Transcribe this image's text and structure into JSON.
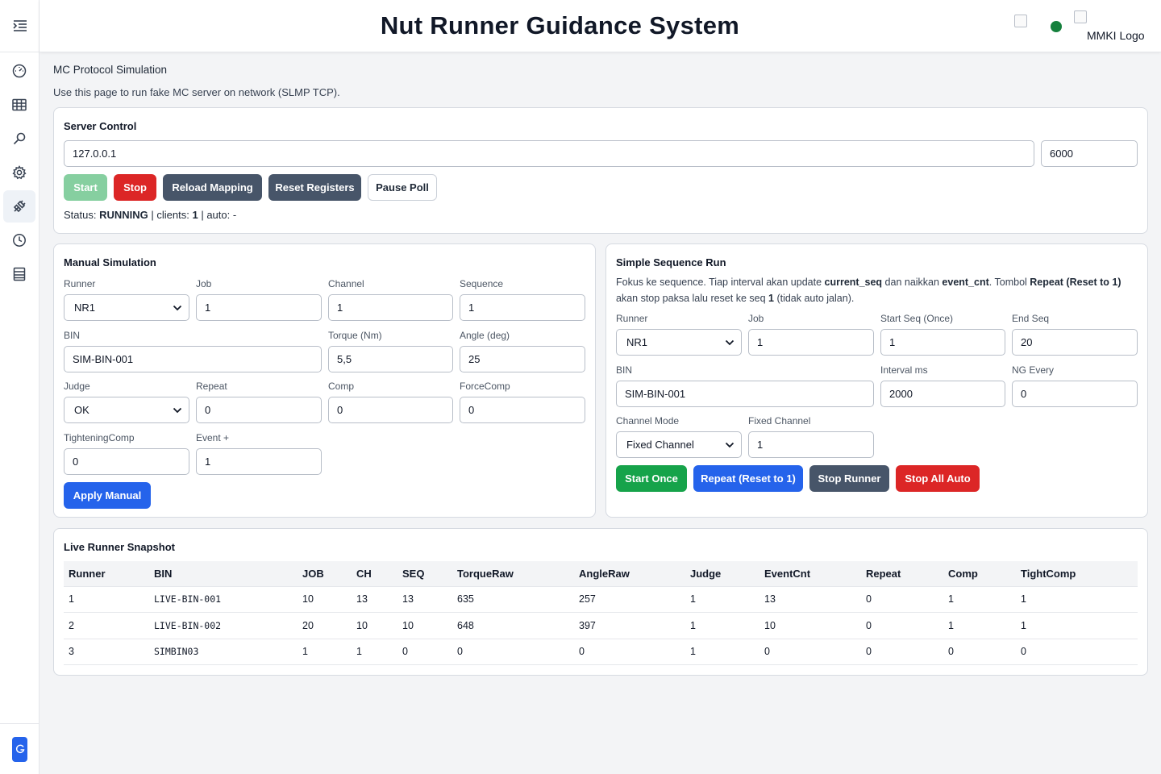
{
  "header": {
    "title": "Nut Runner Guidance System",
    "logo_alt": "MMKI Logo",
    "status_color": "#15803d"
  },
  "sidebar": {
    "items": [
      {
        "icon": "hamburger-menu-icon"
      },
      {
        "icon": "dashboard-gauge-icon"
      },
      {
        "icon": "table-grid-icon"
      },
      {
        "icon": "search-icon"
      },
      {
        "icon": "gear-icon"
      },
      {
        "icon": "plug-link-icon",
        "active": true
      },
      {
        "icon": "clock-history-icon"
      },
      {
        "icon": "list-icon"
      }
    ],
    "avatar_letter": "G"
  },
  "page": {
    "title": "MC Protocol Simulation",
    "description": "Use this page to run fake MC server on network (SLMP TCP)."
  },
  "server_control": {
    "title": "Server Control",
    "host": "127.0.0.1",
    "port": "6000",
    "buttons": {
      "start": "Start",
      "stop": "Stop",
      "reload": "Reload Mapping",
      "reset": "Reset Registers",
      "pause": "Pause Poll"
    },
    "status_label": "Status:",
    "status_value": "RUNNING",
    "clients_label": "| clients:",
    "clients_value": "1",
    "auto_label": "| auto: -"
  },
  "manual": {
    "title": "Manual Simulation",
    "labels": {
      "runner": "Runner",
      "job": "Job",
      "channel": "Channel",
      "sequence": "Sequence",
      "bin": "BIN",
      "torque": "Torque (Nm)",
      "angle": "Angle (deg)",
      "judge": "Judge",
      "repeat": "Repeat",
      "comp": "Comp",
      "forcecomp": "ForceComp",
      "tightcomp": "TighteningComp",
      "event": "Event +"
    },
    "values": {
      "runner": "NR1",
      "job": "1",
      "channel": "1",
      "sequence": "1",
      "bin": "SIM-BIN-001",
      "torque": "5,5",
      "angle": "25",
      "judge": "OK",
      "repeat": "0",
      "comp": "0",
      "forcecomp": "0",
      "tightcomp": "0",
      "event": "1"
    },
    "apply_label": "Apply Manual"
  },
  "sequence": {
    "title": "Simple Sequence Run",
    "desc": {
      "p1": "Fokus ke sequence. Tiap interval akan update ",
      "b1": "current_seq",
      "p2": " dan naikkan ",
      "b2": "event_cnt",
      "p3": ". Tombol ",
      "b3": "Repeat (Reset to 1)",
      "p4": " akan stop paksa lalu reset ke seq ",
      "b4": "1",
      "p5": " (tidak auto jalan)."
    },
    "labels": {
      "runner": "Runner",
      "job": "Job",
      "start_seq": "Start Seq (Once)",
      "end_seq": "End Seq",
      "bin": "BIN",
      "interval": "Interval ms",
      "ng_every": "NG Every",
      "channel_mode": "Channel Mode",
      "fixed_channel": "Fixed Channel"
    },
    "values": {
      "runner": "NR1",
      "job": "1",
      "start_seq": "1",
      "end_seq": "20",
      "bin": "SIM-BIN-001",
      "interval": "2000",
      "ng_every": "0",
      "channel_mode": "Fixed Channel",
      "fixed_channel": "1"
    },
    "buttons": {
      "start_once": "Start Once",
      "repeat": "Repeat (Reset to 1)",
      "stop_runner": "Stop Runner",
      "stop_all": "Stop All Auto"
    }
  },
  "snapshot": {
    "title": "Live Runner Snapshot",
    "columns": [
      "Runner",
      "BIN",
      "JOB",
      "CH",
      "SEQ",
      "TorqueRaw",
      "AngleRaw",
      "Judge",
      "EventCnt",
      "Repeat",
      "Comp",
      "TightComp"
    ],
    "rows": [
      [
        "1",
        "LIVE-BIN-001",
        "10",
        "13",
        "13",
        "635",
        "257",
        "1",
        "13",
        "0",
        "1",
        "1"
      ],
      [
        "2",
        "LIVE-BIN-002",
        "20",
        "10",
        "10",
        "648",
        "397",
        "1",
        "10",
        "0",
        "1",
        "1"
      ],
      [
        "3",
        "SIMBIN03",
        "1",
        "1",
        "0",
        "0",
        "0",
        "1",
        "0",
        "0",
        "0",
        "0"
      ]
    ]
  }
}
